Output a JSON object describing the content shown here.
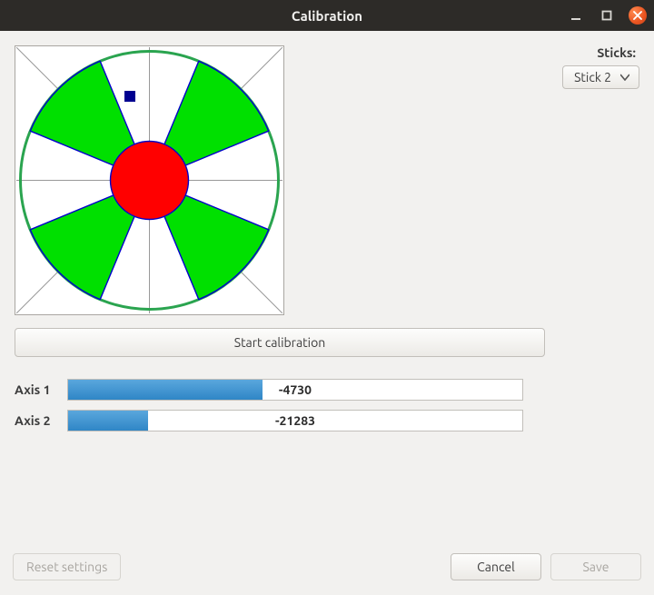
{
  "window": {
    "title": "Calibration"
  },
  "sticks": {
    "label": "Sticks:",
    "selected": "Stick 2"
  },
  "start_button": "Start calibration",
  "axis_range": {
    "min": -32768,
    "max": 32767
  },
  "axes": [
    {
      "label": "Axis 1",
      "value": -4730
    },
    {
      "label": "Axis 2",
      "value": -21283
    }
  ],
  "footer": {
    "reset": "Reset settings",
    "cancel": "Cancel",
    "save": "Save"
  },
  "colors": {
    "accent_close": "#e95420",
    "wedge": "#00e000",
    "deadzone": "#ff0000",
    "ring": "#2aa44f",
    "marker": "#000090",
    "bar_fill_top": "#5aa7dd",
    "bar_fill_bottom": "#2f86c6"
  }
}
